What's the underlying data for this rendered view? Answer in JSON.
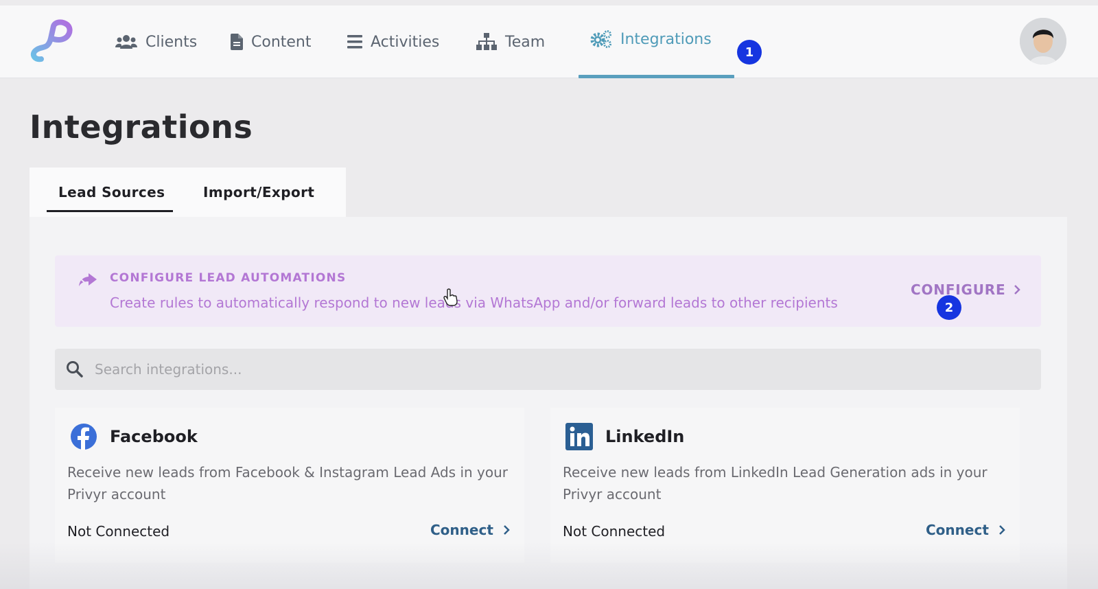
{
  "nav": {
    "items": [
      {
        "label": "Clients",
        "icon": "users-icon"
      },
      {
        "label": "Content",
        "icon": "file-icon"
      },
      {
        "label": "Activities",
        "icon": "list-icon"
      },
      {
        "label": "Team",
        "icon": "sitemap-icon"
      },
      {
        "label": "Integrations",
        "icon": "gears-icon",
        "active": true
      }
    ],
    "markers": [
      "1",
      "2"
    ]
  },
  "page": {
    "title": "Integrations"
  },
  "tabs": [
    {
      "label": "Lead Sources",
      "active": true
    },
    {
      "label": "Import/Export",
      "active": false
    }
  ],
  "banner": {
    "title": "CONFIGURE LEAD AUTOMATIONS",
    "description": "Create rules to automatically respond to new leads via WhatsApp and/or forward leads to other recipients",
    "action": "CONFIGURE"
  },
  "search": {
    "placeholder": "Search integrations..."
  },
  "integrations": [
    {
      "name": "Facebook",
      "icon": "facebook-icon",
      "description": "Receive new leads from Facebook & Instagram Lead Ads in your Privyr account",
      "status": "Not Connected",
      "action": "Connect"
    },
    {
      "name": "LinkedIn",
      "icon": "linkedin-icon",
      "description": "Receive new leads from LinkedIn Lead Generation ads in your Privyr account",
      "status": "Not Connected",
      "action": "Connect"
    }
  ],
  "colors": {
    "accent": "#5a9fbe",
    "banner_text": "#b377d4",
    "connect_link": "#2f5f88",
    "marker": "#1635e0"
  }
}
